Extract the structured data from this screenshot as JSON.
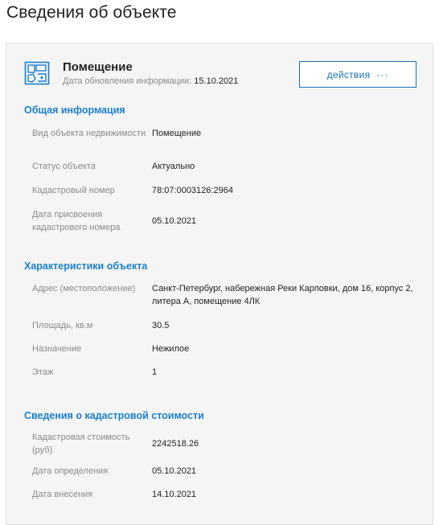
{
  "page": {
    "title": "Сведения об объекте"
  },
  "object": {
    "name": "Помещение",
    "updated_label": "Дата обновления информации:",
    "updated_date": "15.10.2021",
    "actions_label": "действия",
    "actions_dots": "···",
    "icon": "building-plan-icon"
  },
  "sections": {
    "general": {
      "title": "Общая информация",
      "rows": [
        {
          "label": "Вид объекта недвижимости",
          "value": "Помещение"
        },
        {
          "label": "Статус объекта",
          "value": "Актуально"
        },
        {
          "label": "Кадастровый номер",
          "value": "78:07:0003126:2964"
        },
        {
          "label": "Дата присвоения кадастрового номера",
          "value": "05.10.2021"
        }
      ]
    },
    "characteristics": {
      "title": "Характеристики объекта",
      "rows": [
        {
          "label": "Адрес (местоположение)",
          "value": "Санкт-Петербург, набережная Реки Карповки, дом 16, корпус 2, литера А, помещение 4ЛК"
        },
        {
          "label": "Площадь, кв.м",
          "value": "30.5"
        },
        {
          "label": "Назначение",
          "value": "Нежилое"
        },
        {
          "label": "Этаж",
          "value": "1"
        }
      ]
    },
    "cadastral_value": {
      "title": "Сведения о кадастровой стоимости",
      "rows": [
        {
          "label": "Кадастровая стоимость (руб)",
          "value": "2242518.26"
        },
        {
          "label": "Дата определения",
          "value": "05.10.2021"
        },
        {
          "label": "Дата внесения",
          "value": "14.10.2021"
        }
      ]
    }
  },
  "colors": {
    "accent": "#1a7fd0",
    "button_border": "#1a6fb5",
    "card_bg": "#f5f5f5",
    "label": "#8a8a8a"
  }
}
